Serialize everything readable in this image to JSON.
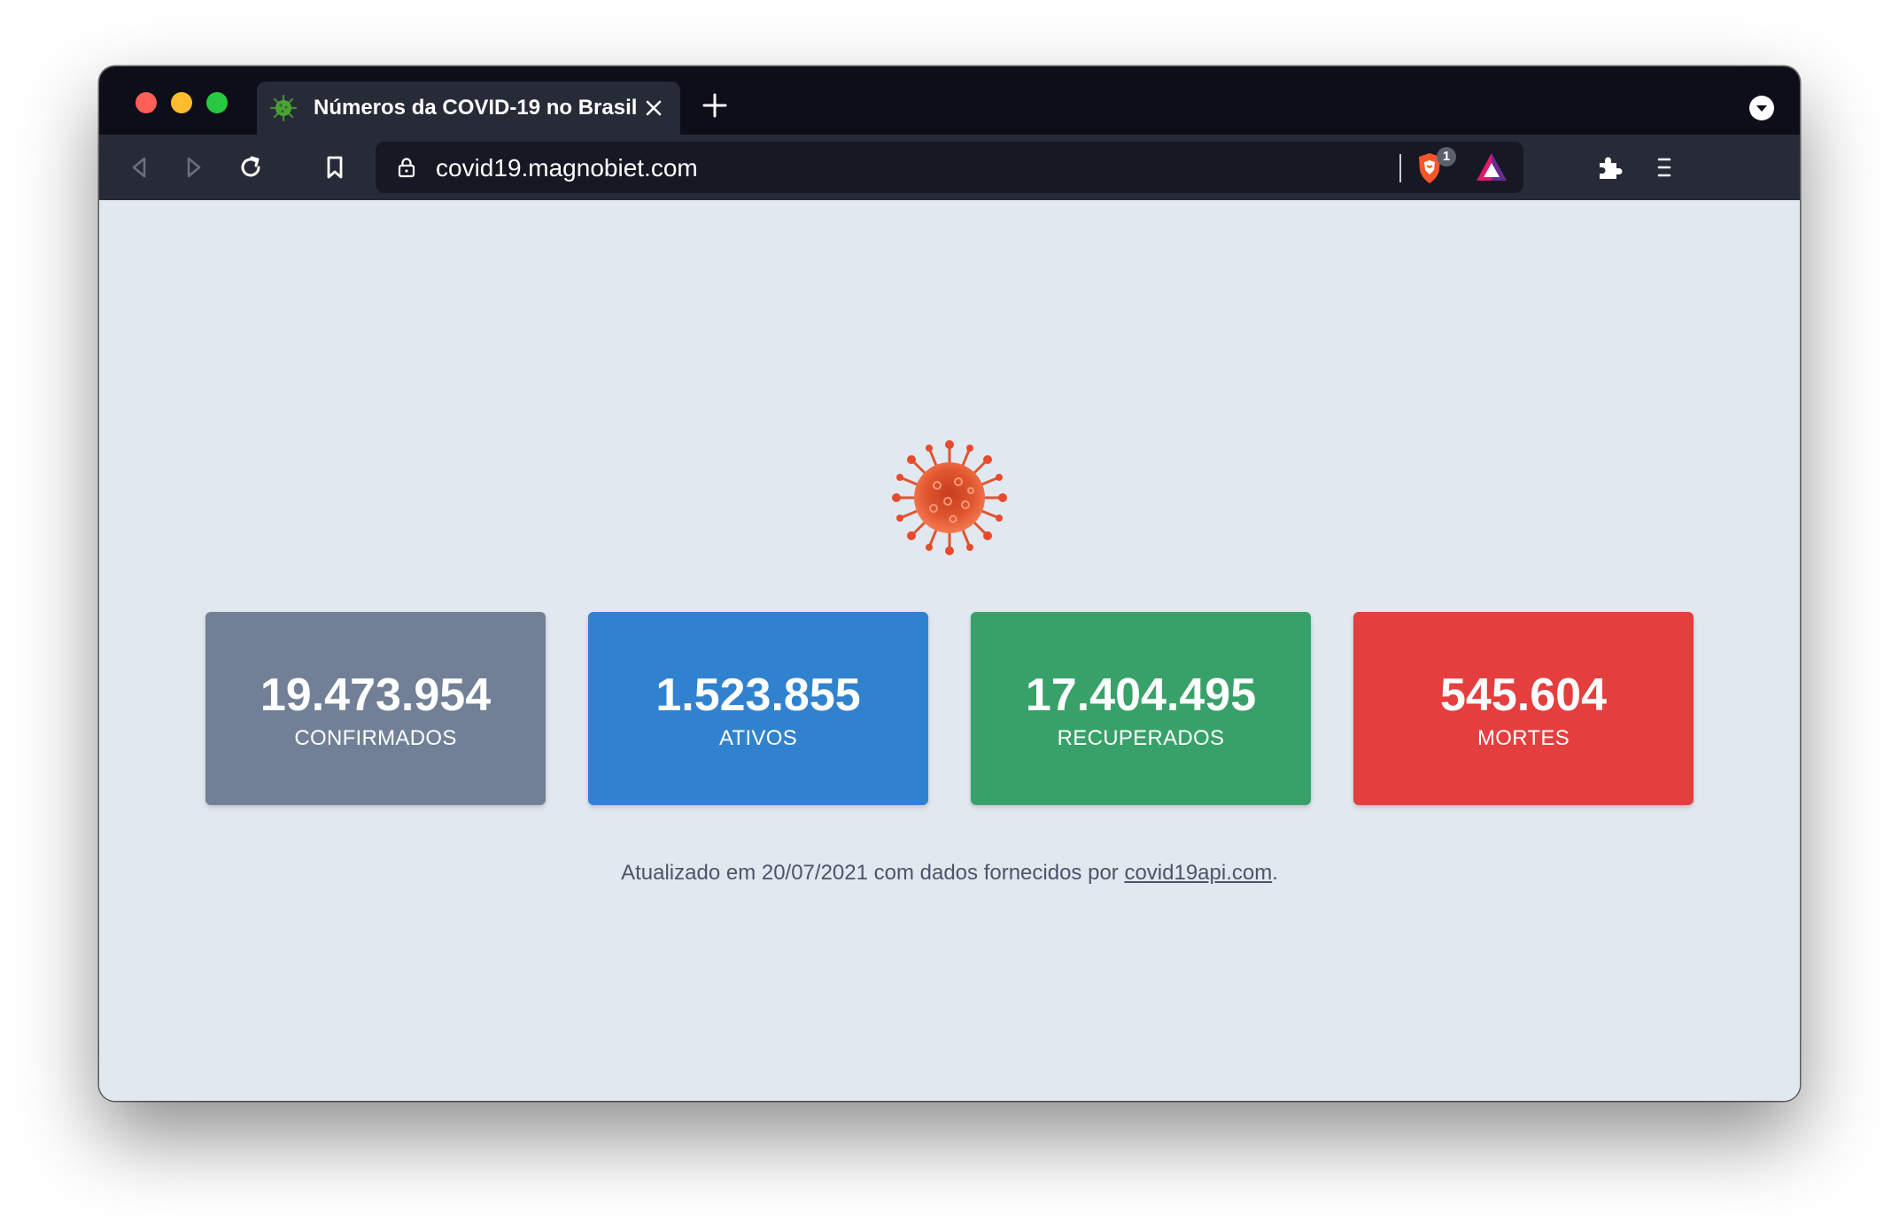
{
  "browser": {
    "tab": {
      "title": "Números da COVID-19 no Brasil",
      "favicon": "virus-icon"
    },
    "url": "covid19.magnobiet.com",
    "shield_count": "1",
    "icons": {
      "back": "back-arrow-icon",
      "forward": "forward-arrow-icon",
      "reload": "reload-icon",
      "bookmark": "bookmark-icon",
      "lock": "lock-icon",
      "shield": "brave-shield-icon",
      "rewards": "brave-rewards-icon",
      "extensions": "puzzle-icon",
      "menu": "hamburger-menu-icon",
      "tab_menu": "chevron-down-icon",
      "new_tab": "plus-icon",
      "close_tab": "close-icon"
    }
  },
  "page": {
    "hero_icon": "virus-icon",
    "stats": [
      {
        "value": "19.473.954",
        "label": "CONFIRMADOS",
        "color": "#718096"
      },
      {
        "value": "1.523.855",
        "label": "ATIVOS",
        "color": "#3182ce"
      },
      {
        "value": "17.404.495",
        "label": "RECUPERADOS",
        "color": "#38a169"
      },
      {
        "value": "545.604",
        "label": "MORTES",
        "color": "#e53e3e"
      }
    ],
    "footer": {
      "prefix": "Atualizado em 20/07/2021 com dados fornecidos por ",
      "link_text": "covid19api.com",
      "suffix": "."
    }
  }
}
